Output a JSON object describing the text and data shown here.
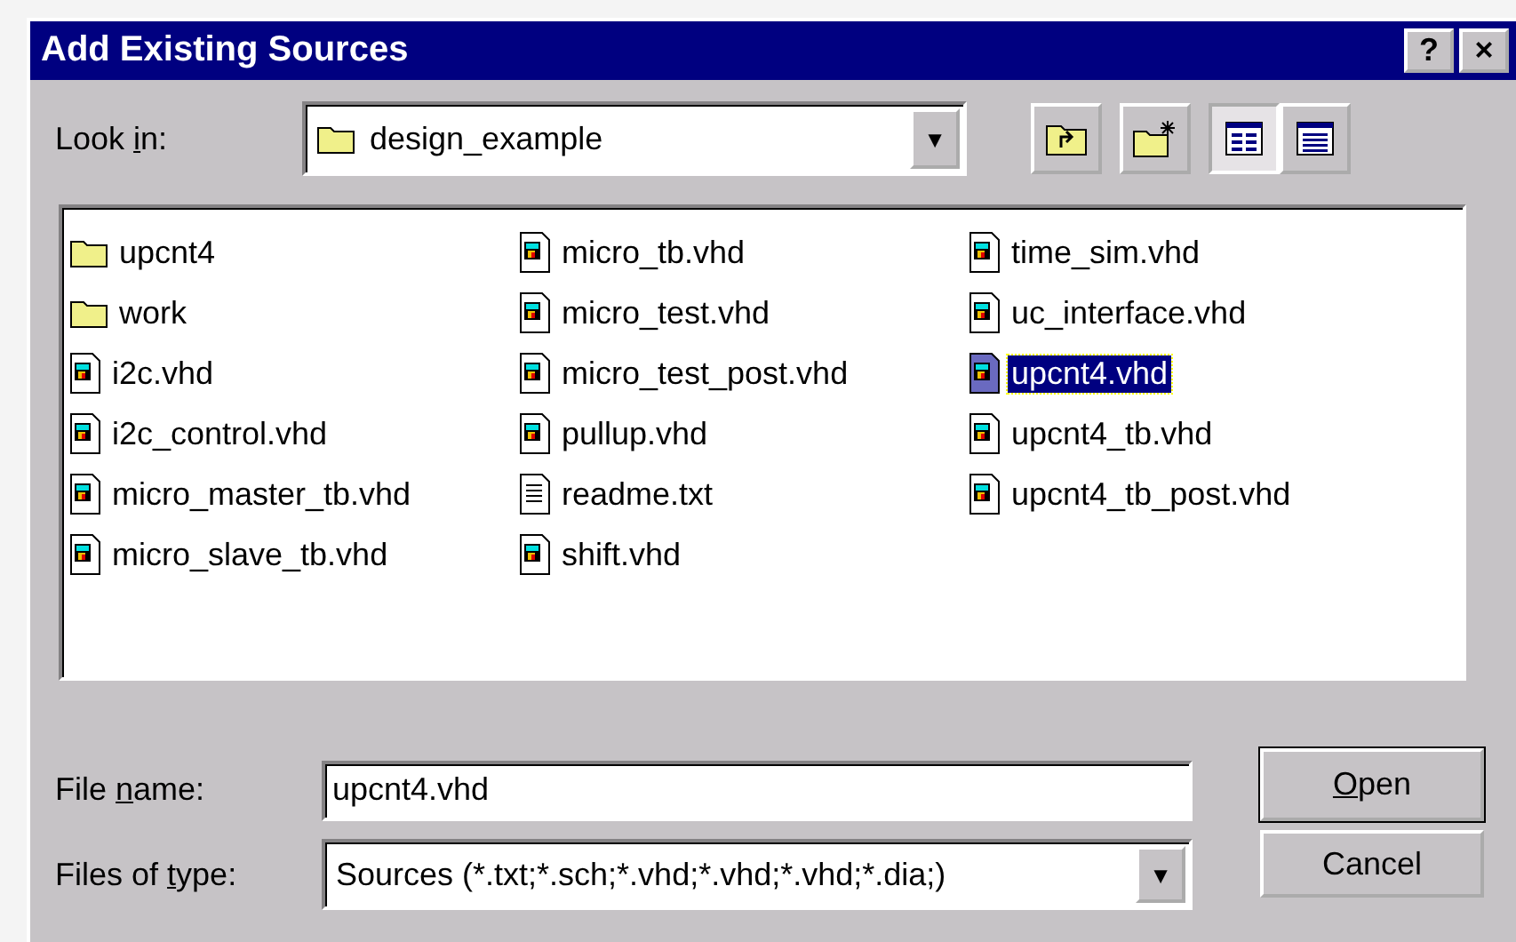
{
  "window": {
    "title": "Add Existing Sources",
    "title_buttons": [
      "?",
      "×"
    ]
  },
  "look_in": {
    "label_parts": [
      "Look ",
      "i",
      "n:"
    ],
    "value": "design_example",
    "dropdown": "▼"
  },
  "toolbar": [
    {
      "kind": "up-folder",
      "selected": false
    },
    {
      "kind": "new-folder",
      "selected": false
    },
    {
      "kind": "list-view",
      "selected": true
    },
    {
      "kind": "details-view",
      "selected": false
    }
  ],
  "files": [
    {
      "name": "upcnt4",
      "kind": "folder",
      "selected": false
    },
    {
      "name": "work",
      "kind": "folder",
      "selected": false
    },
    {
      "name": "i2c.vhd",
      "kind": "vhd",
      "selected": false
    },
    {
      "name": "i2c_control.vhd",
      "kind": "vhd",
      "selected": false
    },
    {
      "name": "micro_master_tb.vhd",
      "kind": "vhd",
      "selected": false
    },
    {
      "name": "micro_slave_tb.vhd",
      "kind": "vhd",
      "selected": false
    },
    {
      "name": "micro_tb.vhd",
      "kind": "vhd",
      "selected": false
    },
    {
      "name": "micro_test.vhd",
      "kind": "vhd",
      "selected": false
    },
    {
      "name": "micro_test_post.vhd",
      "kind": "vhd",
      "selected": false
    },
    {
      "name": "pullup.vhd",
      "kind": "vhd",
      "selected": false
    },
    {
      "name": "readme.txt",
      "kind": "txt",
      "selected": false
    },
    {
      "name": "shift.vhd",
      "kind": "vhd",
      "selected": false
    },
    {
      "name": "time_sim.vhd",
      "kind": "vhd",
      "selected": false
    },
    {
      "name": "uc_interface.vhd",
      "kind": "vhd",
      "selected": false
    },
    {
      "name": "upcnt4.vhd",
      "kind": "vhd",
      "selected": true
    },
    {
      "name": "upcnt4_tb.vhd",
      "kind": "vhd",
      "selected": false
    },
    {
      "name": "upcnt4_tb_post.vhd",
      "kind": "vhd",
      "selected": false
    }
  ],
  "file_name": {
    "label_parts": [
      "File ",
      "n",
      "ame:"
    ],
    "value": "upcnt4.vhd"
  },
  "file_type": {
    "label_parts": [
      "Files of ",
      "t",
      "ype:"
    ],
    "value": "Sources (*.txt;*.sch;*.vhd;*.vhd;*.vhd;*.dia;)",
    "dropdown": "▼"
  },
  "buttons": [
    {
      "label": "Open",
      "first_letter_underlined": true,
      "default": true
    },
    {
      "label": "Cancel",
      "first_letter_underlined": false,
      "default": false
    }
  ]
}
